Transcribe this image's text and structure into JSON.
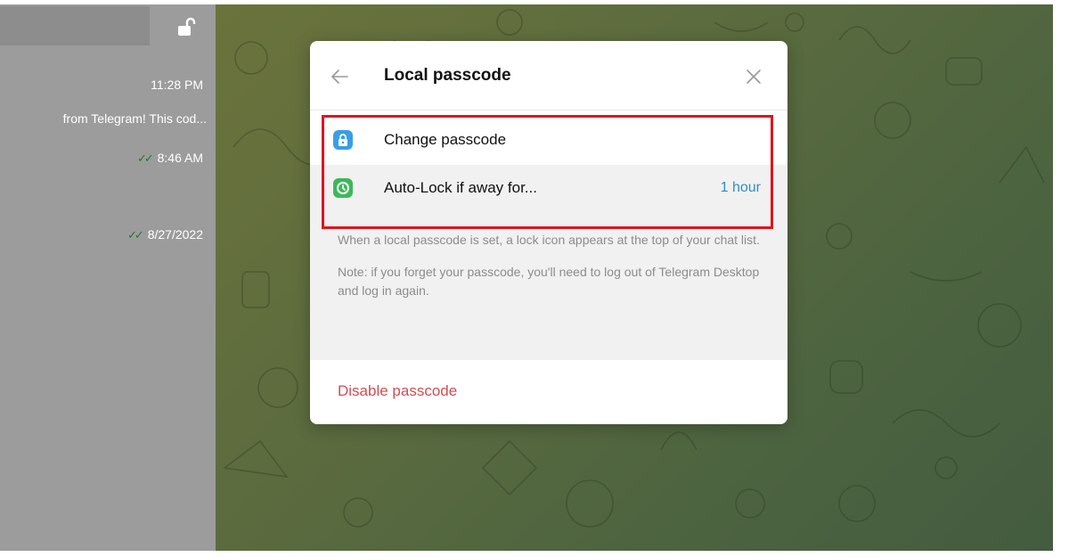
{
  "sidebar": {
    "chats": [
      {
        "time": "11:28 PM",
        "preview": "from Telegram! This cod..."
      },
      {
        "time": "8:46 AM",
        "read": true
      },
      {
        "time": "8/27/2022",
        "read": true
      }
    ],
    "check_glyph": "✓✓"
  },
  "modal": {
    "title": "Local passcode",
    "items": [
      {
        "label": "Change passcode",
        "icon": "lock-icon"
      },
      {
        "label": "Auto-Lock if away for...",
        "value": "1 hour",
        "icon": "clock-icon"
      }
    ],
    "info": [
      "When a local passcode is set, a lock icon appears at the top of your chat list.",
      "Note: if you forget your passcode, you'll need to log out of Telegram Desktop and log in again."
    ],
    "disable_label": "Disable passcode"
  },
  "colors": {
    "accent": "#2f8ec9",
    "lock_icon_bg": "#3a9ee6",
    "clock_icon_bg": "#3cb85a",
    "danger": "#d54c52",
    "highlight": "#e0141e"
  }
}
